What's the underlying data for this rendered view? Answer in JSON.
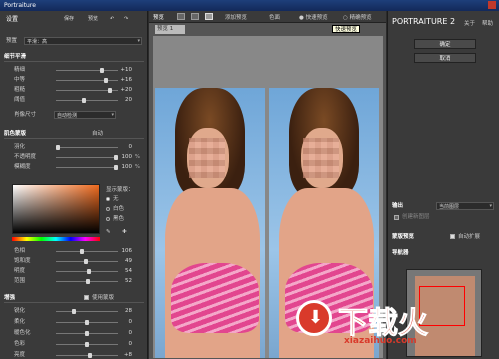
{
  "app": {
    "title": "Portraiture"
  },
  "left": {
    "tab_settings": "设置",
    "btn_save": "保存",
    "btn_default": "预览",
    "preset_label": "预置",
    "preset_value": "平滑：高",
    "detail_section": "细节平滑",
    "detail_sliders": [
      {
        "label": "精细",
        "value": "+10",
        "pos": 0.75
      },
      {
        "label": "中等",
        "value": "+16",
        "pos": 0.82
      },
      {
        "label": "粗糙",
        "value": "+20",
        "pos": 0.9
      },
      {
        "label": "阈值",
        "value": "20",
        "pos": 0.45
      }
    ],
    "feature_size_label": "肖像尺寸",
    "feature_size_value": "自动检测",
    "skin_section": "肌色蒙版",
    "skin_mode": "自动",
    "skin_sliders": [
      {
        "label": "羽化",
        "value": "0",
        "unit": "",
        "pos": 0.0
      },
      {
        "label": "不透明度",
        "value": "100",
        "unit": "%",
        "pos": 1.0
      },
      {
        "label": "模糊度",
        "value": "100",
        "unit": "%",
        "pos": 1.0
      }
    ],
    "display_mask_label": "显示蒙版：",
    "radios": [
      "无",
      "白色",
      "黑色"
    ],
    "color_sliders": [
      {
        "label": "色相",
        "value": "106",
        "pos": 0.42
      },
      {
        "label": "饱和度",
        "value": "49",
        "pos": 0.49
      },
      {
        "label": "明度",
        "value": "54",
        "pos": 0.54
      },
      {
        "label": "范围",
        "value": "52",
        "pos": 0.52
      }
    ],
    "enhance_section": "增强",
    "use_mask_label": "使用蒙版",
    "enhance_sliders": [
      {
        "label": "锐化",
        "value": "28",
        "pos": 0.28
      },
      {
        "label": "柔化",
        "value": "0",
        "pos": 0.5
      },
      {
        "label": "暖色化",
        "value": "0",
        "pos": 0.5
      },
      {
        "label": "色彩",
        "value": "0",
        "pos": 0.5
      },
      {
        "label": "亮度",
        "value": "+8",
        "pos": 0.56
      }
    ]
  },
  "center": {
    "preview_label": "预览",
    "add_preview": "添加预览",
    "overlay_label": "色面",
    "fast_preview": "快速预览",
    "precise_preview": "精确预览",
    "tooltip": "快速预览",
    "tab_preview": "预览 1"
  },
  "right": {
    "brand": "PORTRAITURE 2",
    "about": "关于",
    "help": "帮助",
    "ok": "确定",
    "cancel": "取消",
    "output_label": "输出",
    "output_value": "当前图层",
    "new_layer_label": "创建新图层",
    "mask_preview_label": "蒙版预览",
    "auto_expand_label": "自动扩展",
    "navigator_label": "导航器"
  },
  "watermark": {
    "title": "下载火",
    "url": "xiazaihuo.com"
  }
}
